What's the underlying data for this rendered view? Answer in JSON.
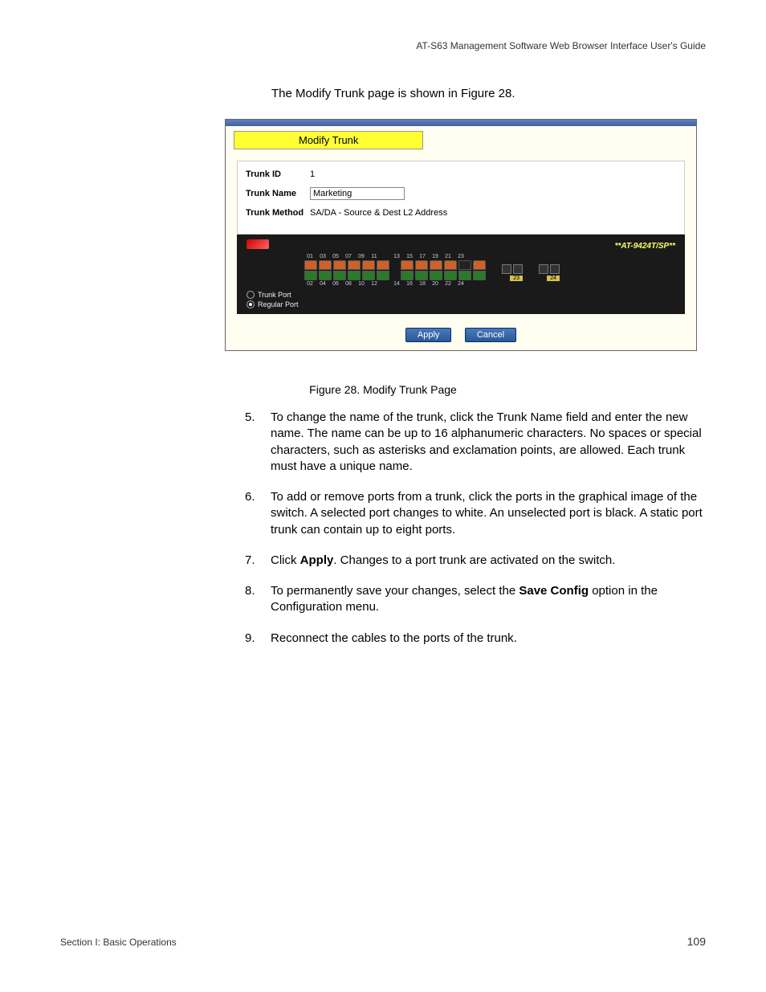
{
  "header": "AT-S63 Management Software Web Browser Interface User's Guide",
  "intro": "The Modify Trunk page is shown in Figure 28.",
  "panel": {
    "title": "Modify Trunk",
    "fields": {
      "trunk_id_label": "Trunk ID",
      "trunk_id_value": "1",
      "trunk_name_label": "Trunk Name",
      "trunk_name_value": "Marketing",
      "trunk_method_label": "Trunk Method",
      "trunk_method_value": "SA/DA - Source & Dest L2 Address"
    },
    "switch": {
      "model": "**AT-9424T/SP**",
      "top_ports": [
        "01",
        "03",
        "05",
        "07",
        "09",
        "11",
        "13",
        "15",
        "17",
        "19",
        "21",
        "23"
      ],
      "bottom_ports": [
        "02",
        "04",
        "06",
        "08",
        "10",
        "12",
        "14",
        "16",
        "18",
        "20",
        "22",
        "24"
      ],
      "sfp_left": "23",
      "sfp_right": "24",
      "legend_trunk": "Trunk Port",
      "legend_regular": "Regular Port"
    },
    "buttons": {
      "apply": "Apply",
      "cancel": "Cancel"
    }
  },
  "figure_caption": "Figure 28. Modify Trunk Page",
  "steps": [
    {
      "num": "5.",
      "text": "To change the name of the trunk, click the Trunk Name field and enter the new name. The name can be up to 16 alphanumeric characters. No spaces or special characters, such as asterisks and exclamation points, are allowed. Each trunk must have a unique name."
    },
    {
      "num": "6.",
      "text": "To add or remove ports from a trunk, click the ports in the graphical image of the switch. A selected port changes to white. An unselected port is black. A static port trunk can contain up to eight ports."
    },
    {
      "num": "7.",
      "prefix": "Click ",
      "bold": "Apply",
      "suffix": ". Changes to a port trunk are activated on the switch."
    },
    {
      "num": "8.",
      "prefix": "To permanently save your changes, select the ",
      "bold": "Save Config",
      "suffix": " option in the Configuration menu."
    },
    {
      "num": "9.",
      "text": "Reconnect the cables to the ports of the trunk."
    }
  ],
  "footer": {
    "left": "Section I: Basic Operations",
    "right": "109"
  }
}
